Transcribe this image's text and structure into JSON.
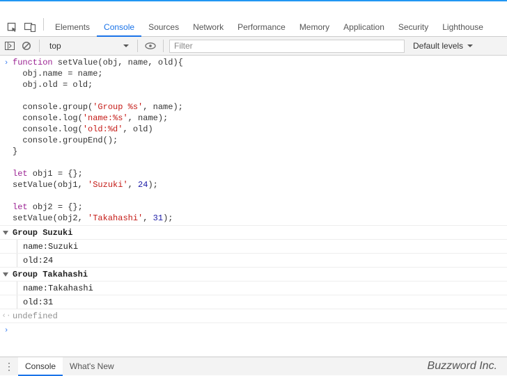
{
  "tabs": {
    "elements": "Elements",
    "console": "Console",
    "sources": "Sources",
    "network": "Network",
    "performance": "Performance",
    "memory": "Memory",
    "application": "Application",
    "security": "Security",
    "lighthouse": "Lighthouse"
  },
  "toolbar": {
    "context": "top",
    "filter_placeholder": "Filter",
    "levels": "Default levels"
  },
  "code": {
    "l1a": "function",
    "l1b": " setValue(obj, name, old){",
    "l2": "  obj.name = name;",
    "l3": "  obj.old = old;",
    "blank": "",
    "l5a": "  console.group(",
    "l5b": "'Group %s'",
    "l5c": ", name);",
    "l6a": "  console.log(",
    "l6b": "'name:%s'",
    "l6c": ", name);",
    "l7a": "  console.log(",
    "l7b": "'old:%d'",
    "l7c": ", old)",
    "l8": "  console.groupEnd();",
    "l9": "}",
    "l11a": "let",
    "l11b": " obj1 = {};",
    "l12a": "setValue(obj1, ",
    "l12b": "'Suzuki'",
    "l12c": ", ",
    "l12d": "24",
    "l12e": ");",
    "l14a": "let",
    "l14b": " obj2 = {};",
    "l15a": "setValue(obj2, ",
    "l15b": "'Takahashi'",
    "l15c": ", ",
    "l15d": "31",
    "l15e": ");"
  },
  "groups": [
    {
      "title": "Group Suzuki",
      "name_line": "name:Suzuki",
      "old_line": "old:24"
    },
    {
      "title": "Group Takahashi",
      "name_line": "name:Takahashi",
      "old_line": "old:31"
    }
  ],
  "return_value": "undefined",
  "drawer": {
    "console": "Console",
    "whatsnew": "What's New"
  },
  "brand": "Buzzword Inc."
}
